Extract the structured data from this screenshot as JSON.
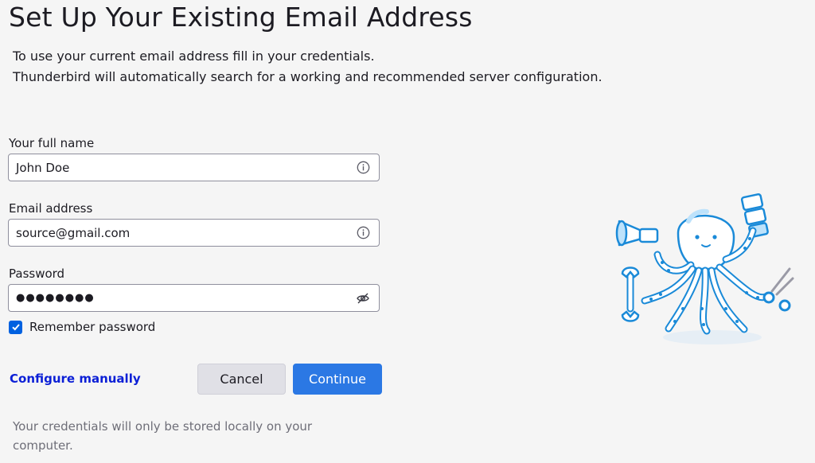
{
  "page": {
    "title": "Set Up Your Existing Email Address",
    "description_line1": "To use your current email address fill in your credentials.",
    "description_line2": "Thunderbird will automatically search for a working and recommended server configuration."
  },
  "form": {
    "full_name": {
      "label": "Your full name",
      "value": "John Doe",
      "icon": "info-icon"
    },
    "email": {
      "label": "Email address",
      "value": "source@gmail.com",
      "icon": "info-icon"
    },
    "password": {
      "label": "Password",
      "value": "●●●●●●●●",
      "icon": "eye-slash-icon"
    },
    "remember_password": {
      "label": "Remember password",
      "checked": true
    }
  },
  "actions": {
    "configure_manually": "Configure manually",
    "cancel": "Cancel",
    "continue": "Continue"
  },
  "footnote": "Your credentials will only be stored locally on your computer.",
  "colors": {
    "accent": "#2b78e4",
    "link": "#0b1fd6",
    "checkbox": "#0061e0",
    "mascot_outline": "#1a8ad8"
  }
}
